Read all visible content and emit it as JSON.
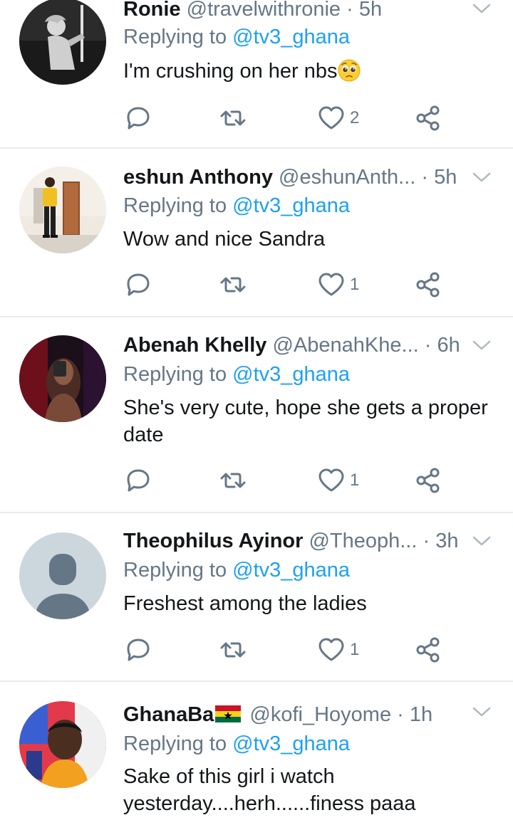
{
  "tweets": [
    {
      "name": "Ronie",
      "handle": "@travelwithronie",
      "dot": "·",
      "time": "5h",
      "reply_prefix": "Replying to",
      "reply_mention": "@tv3_ghana",
      "text": "I'm crushing on her nbs",
      "text_emoji": "pleading-face-emoji",
      "likes": "2"
    },
    {
      "name": "eshun Anthony",
      "handle": "@eshunAnth...",
      "dot": "·",
      "time": "5h",
      "reply_prefix": "Replying to",
      "reply_mention": "@tv3_ghana",
      "text": "Wow and nice Sandra",
      "likes": "1"
    },
    {
      "name": "Abenah Khelly",
      "handle": "@AbenahKhe...",
      "dot": "·",
      "time": "6h",
      "reply_prefix": "Replying to",
      "reply_mention": "@tv3_ghana",
      "text_line1": "She's very cute, hope she gets a proper",
      "text_line2": "date",
      "likes": "1"
    },
    {
      "name": "Theophilus Ayinor",
      "handle": "@Theoph...",
      "dot": "·",
      "time": "3h",
      "reply_prefix": "Replying to",
      "reply_mention": "@tv3_ghana",
      "text": "Freshest among the ladies",
      "likes": "1"
    },
    {
      "name": "GhanaBa",
      "name_flag": "ghana-flag-emoji",
      "handle": "@kofi_Hoyome",
      "dot": "·",
      "time": "1h",
      "reply_prefix": "Replying to",
      "reply_mention": "@tv3_ghana",
      "text_line1": "Sake of this girl i watch",
      "text_line2": "yesterday....herh......finess paaa"
    }
  ],
  "icons": {
    "reply": "reply-icon",
    "retweet": "retweet-icon",
    "like": "like-icon",
    "share": "share-icon",
    "more": "chevron-down-icon"
  },
  "colors": {
    "name": "#14171a",
    "secondary": "#657786",
    "mention": "#1da1f2",
    "divider": "#e6ecf0"
  }
}
